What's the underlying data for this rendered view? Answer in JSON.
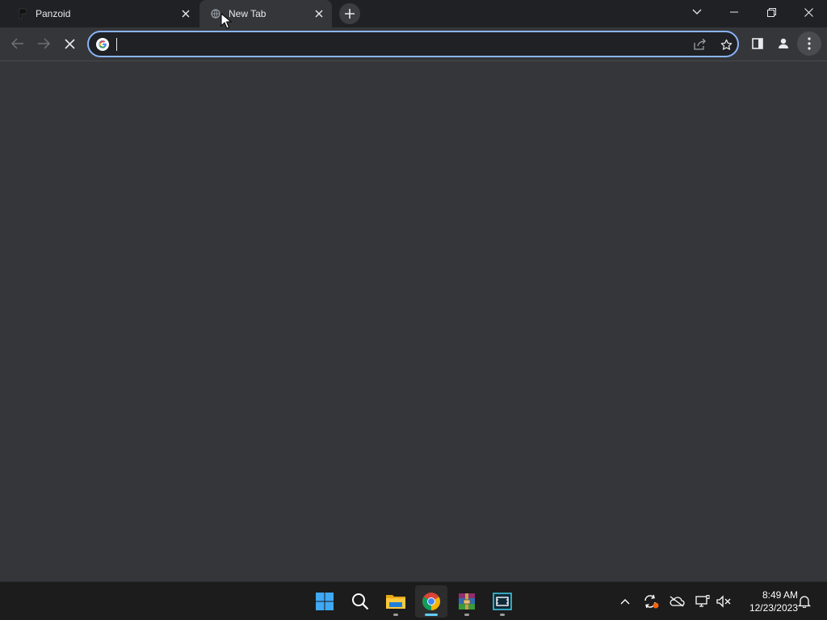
{
  "browser": {
    "tabs": [
      {
        "title": "Panzoid",
        "active": false,
        "favicon": "panzoid-favicon"
      },
      {
        "title": "New Tab",
        "active": true,
        "favicon": "loading-globe-icon"
      }
    ],
    "new_tab_icon": "plus-icon",
    "window_controls": [
      "tab-search-icon",
      "minimize-icon",
      "restore-icon",
      "close-icon"
    ],
    "toolbar": {
      "back_icon": "back-arrow-icon",
      "forward_icon": "forward-arrow-icon",
      "stop_icon": "stop-loading-icon",
      "address_value": "",
      "address_placeholder": "",
      "search_engine_icon": "google-icon",
      "share_icon": "share-icon",
      "bookmark_icon": "star-icon",
      "side_panel_icon": "side-panel-icon",
      "profile_icon": "profile-icon",
      "menu_icon": "kebab-menu-icon"
    }
  },
  "taskbar": {
    "apps": [
      {
        "name": "start",
        "icon": "windows-start-icon",
        "open": false
      },
      {
        "name": "search",
        "icon": "search-icon",
        "open": false
      },
      {
        "name": "file-explorer",
        "icon": "folder-icon",
        "open": true
      },
      {
        "name": "chrome",
        "icon": "chrome-icon",
        "open": true,
        "active": true
      },
      {
        "name": "winrar",
        "icon": "winrar-icon",
        "open": true
      },
      {
        "name": "video-editor",
        "icon": "film-icon",
        "open": true
      }
    ],
    "tray": [
      "chevron-up-icon",
      "sync-icon",
      "onedrive-offline-icon",
      "network-icon",
      "volume-muted-icon",
      "notification-bell-icon"
    ],
    "time": "8:49 AM",
    "date": "12/23/2023"
  },
  "colors": {
    "accent": "#8ab4f8",
    "chrome_dark": "#202124",
    "chrome_surface": "#35363a",
    "taskbar": "#1c1c1c",
    "taskbar_active_indicator": "#60cdff"
  }
}
